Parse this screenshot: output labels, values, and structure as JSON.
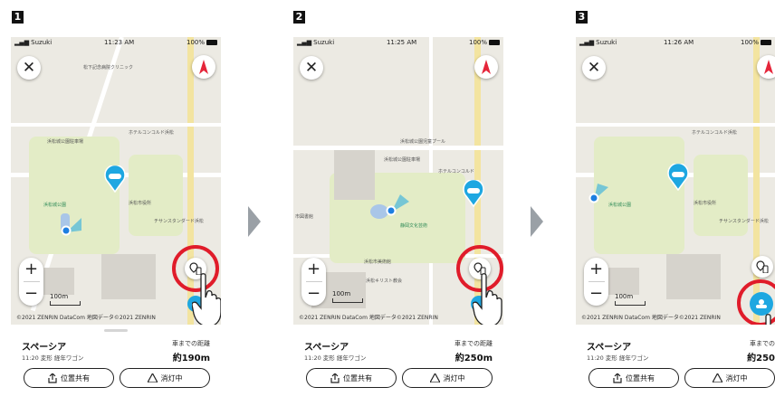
{
  "steps": [
    {
      "number": "1",
      "status": {
        "carrier": "Suzuki",
        "time": "11:23 AM",
        "battery": "100%"
      },
      "map": {
        "labels": [
          "松下記念病院クリニック",
          "浜松城公園駐車場",
          "ホテルコンコルド浜松",
          "浜松市役所",
          "浜松城公園",
          "チサンスタンダード浜松"
        ],
        "scale_label": "100m",
        "copyright": "©2021 ZENRIN DataCom 地図データ©2021 ZENRIN"
      },
      "panel": {
        "place_name": "スペーシア",
        "time": "11:20 変形 経年ワゴン",
        "distance_label": "車までの距離",
        "distance_value": "約190m"
      },
      "buttons": {
        "share": "位置共有",
        "light": "消灯中"
      }
    },
    {
      "number": "2",
      "status": {
        "carrier": "Suzuki",
        "time": "11:25 AM",
        "battery": "100%"
      },
      "map": {
        "labels": [
          "浜松城公園駐車場",
          "浜松城公園児童プール",
          "ホテルコンコルド",
          "市図書館",
          "浜松市美術館",
          "浜松キリスト教会",
          "静岡文化芸術"
        ],
        "scale_label": "100m",
        "copyright": "©2021 ZENRIN DataCom 地図データ©2021 ZENRIN"
      },
      "panel": {
        "place_name": "スペーシア",
        "time": "11:20 変形 経年ワゴン",
        "distance_label": "車までの距離",
        "distance_value": "約250m"
      },
      "buttons": {
        "share": "位置共有",
        "light": "消灯中"
      }
    },
    {
      "number": "3",
      "status": {
        "carrier": "Suzuki",
        "time": "11:26 AM",
        "battery": "100%"
      },
      "map": {
        "labels": [
          "浜松城公園",
          "浜松市役所",
          "ホテルコンコルド浜松",
          "チサンスタンダード浜松"
        ],
        "scale_label": "100m",
        "copyright": "©2021 ZENRIN DataCom 地図データ©2021 ZENRIN"
      },
      "panel": {
        "place_name": "スペーシア",
        "time": "11:20 変形 経年ワゴン",
        "distance_label": "車までの",
        "distance_value": "約250"
      },
      "buttons": {
        "share": "位置共有",
        "light": "消灯中"
      }
    }
  ],
  "colors": {
    "accent": "#1ea7e1",
    "highlight_ring": "#e01c2a",
    "compass_red": "#e5253a"
  }
}
